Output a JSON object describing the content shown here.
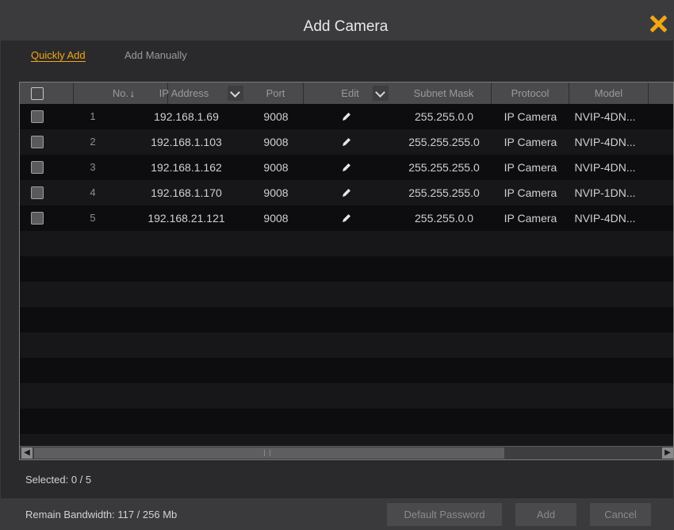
{
  "dialog": {
    "title": "Add Camera"
  },
  "tabs": [
    {
      "label": "Quickly Add",
      "active": true
    },
    {
      "label": "Add Manually",
      "active": false
    }
  ],
  "table": {
    "headers": {
      "no": "No.",
      "ip": "IP Address",
      "port": "Port",
      "edit": "Edit",
      "subnet": "Subnet Mask",
      "protocol": "Protocol",
      "model": "Model"
    },
    "rows": [
      {
        "no": "1",
        "ip": "192.168.1.69",
        "port": "9008",
        "subnet": "255.255.0.0",
        "protocol": "IP Camera",
        "model": "NVIP-4DN..."
      },
      {
        "no": "2",
        "ip": "192.168.1.103",
        "port": "9008",
        "subnet": "255.255.255.0",
        "protocol": "IP Camera",
        "model": "NVIP-4DN..."
      },
      {
        "no": "3",
        "ip": "192.168.1.162",
        "port": "9008",
        "subnet": "255.255.255.0",
        "protocol": "IP Camera",
        "model": "NVIP-4DN..."
      },
      {
        "no": "4",
        "ip": "192.168.1.170",
        "port": "9008",
        "subnet": "255.255.255.0",
        "protocol": "IP Camera",
        "model": "NVIP-1DN..."
      },
      {
        "no": "5",
        "ip": "192.168.21.121",
        "port": "9008",
        "subnet": "255.255.0.0",
        "protocol": "IP Camera",
        "model": "NVIP-4DN..."
      }
    ]
  },
  "status": {
    "selected": "Selected: 0 / 5",
    "bandwidth": "Remain Bandwidth: 117 / 256 Mb"
  },
  "buttons": {
    "default_password": "Default Password",
    "add": "Add",
    "cancel": "Cancel"
  },
  "colors": {
    "accent": "#f2a614",
    "header_bg": "#4a4a4c",
    "table_bg": "#101012"
  },
  "icons": {
    "close": "close-icon",
    "edit": "pencil-icon",
    "sort": "sort-arrow-icon",
    "dropdown": "chevron-down-icon"
  }
}
